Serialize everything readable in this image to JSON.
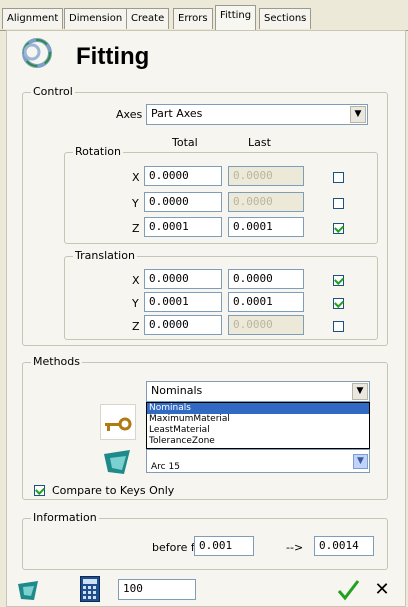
{
  "tabs": [
    "Alignment",
    "Dimension",
    "Create",
    "Errors",
    "Fitting",
    "Sections"
  ],
  "active_tab": "Fitting",
  "title": "Fitting",
  "control": {
    "group_label": "Control",
    "axes_label": "Axes",
    "axes_value": "Part Axes",
    "col_total": "Total",
    "col_last": "Last",
    "rotation": {
      "label": "Rotation",
      "rows": [
        {
          "axis": "X",
          "total": "0.0000",
          "last": "0.0000",
          "checked": false,
          "last_enabled": false
        },
        {
          "axis": "Y",
          "total": "0.0000",
          "last": "0.0000",
          "checked": false,
          "last_enabled": false
        },
        {
          "axis": "Z",
          "total": "0.0001",
          "last": "0.0001",
          "checked": true,
          "last_enabled": true
        }
      ]
    },
    "translation": {
      "label": "Translation",
      "rows": [
        {
          "axis": "X",
          "total": "0.0000",
          "last": "0.0000",
          "checked": true,
          "last_enabled": true
        },
        {
          "axis": "Y",
          "total": "0.0001",
          "last": "0.0001",
          "checked": true,
          "last_enabled": true
        },
        {
          "axis": "Z",
          "total": "0.0000",
          "last": "0.0000",
          "checked": false,
          "last_enabled": false
        }
      ]
    }
  },
  "methods": {
    "group_label": "Methods",
    "selected": "Nominals",
    "options": [
      "Nominals",
      "MaximumMaterial",
      "LeastMaterial",
      "ToleranceZone"
    ],
    "highlighted": "Nominals",
    "partial_items": [
      "Arc 15"
    ],
    "compare_label": "Compare to Keys Only",
    "compare_checked": true
  },
  "information": {
    "group_label": "Information",
    "before_fit_label": "before fit",
    "before_value": "0.001",
    "arrow": "-->",
    "after_value": "0.0014"
  },
  "footer": {
    "value": "100"
  },
  "colors": {
    "panel_bg": "#f6f5ef",
    "accent": "#316ac5",
    "ok_check": "#21a121"
  }
}
